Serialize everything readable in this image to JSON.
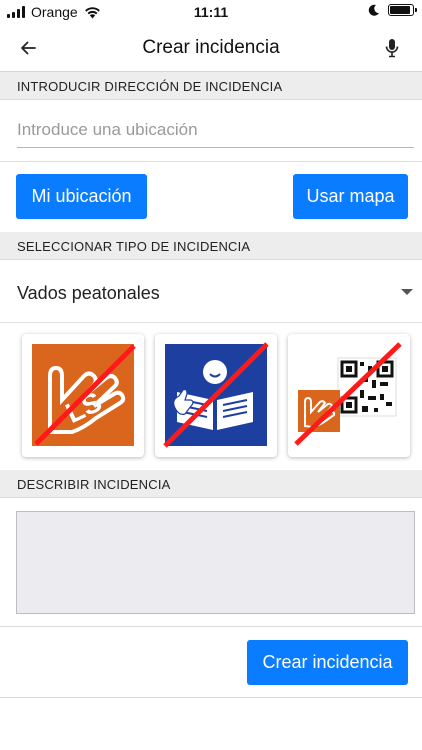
{
  "status_bar": {
    "carrier": "Orange",
    "time": "11:11",
    "battery_level": 0.9
  },
  "header": {
    "title": "Crear incidencia"
  },
  "sections": {
    "address": "INTRODUCIR DIRECCIÓN DE INCIDENCIA",
    "type": "SELECCIONAR TIPO DE INCIDENCIA",
    "describe": "DESCRIBIR INCIDENCIA"
  },
  "location": {
    "placeholder": "Introduce una ubicación",
    "value": ""
  },
  "buttons": {
    "my_location": "Mi ubicación",
    "use_map": "Usar mapa",
    "create": "Crear incidencia"
  },
  "type_select": {
    "selected": "Vados peatonales"
  },
  "description": {
    "value": ""
  },
  "icons": {
    "back": "arrow-left-icon",
    "mic": "microphone-icon",
    "dropdown": "caret-down-icon",
    "cards": [
      "no-sign-language-icon",
      "no-easy-reading-icon",
      "no-qr-signlanguage-icon"
    ]
  },
  "colors": {
    "accent": "#0a7cff",
    "section_bg": "#ededed",
    "strike_red": "#ff1a1a",
    "sign_orange": "#d9661c",
    "easy_read_blue": "#1c3fa0"
  }
}
